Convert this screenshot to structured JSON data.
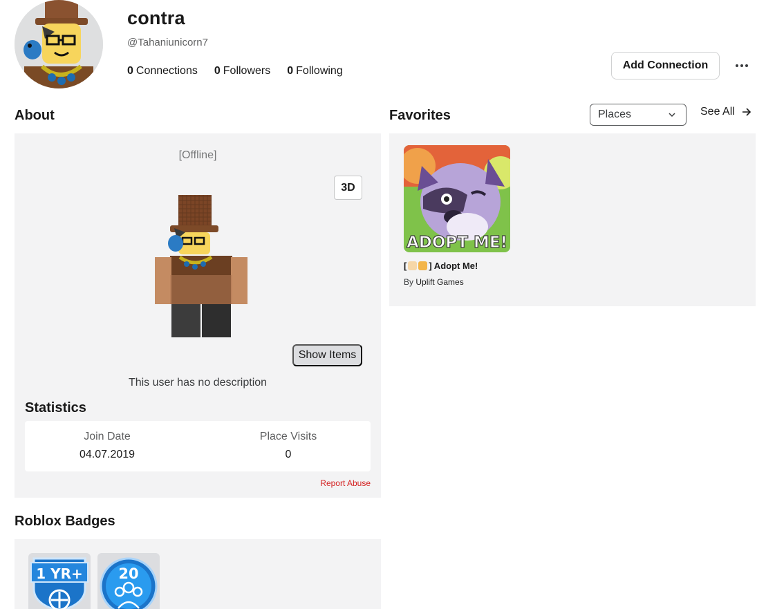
{
  "profile": {
    "display_name": "contra",
    "username": "@Tahaniunicorn7",
    "connections": {
      "count": "0",
      "label": "Connections"
    },
    "followers": {
      "count": "0",
      "label": "Followers"
    },
    "following": {
      "count": "0",
      "label": "Following"
    },
    "add_connection_label": "Add Connection",
    "more_icon": "ellipsis-icon"
  },
  "about": {
    "title": "About",
    "status": "[Offline]",
    "view_toggle_label": "3D",
    "show_items_label": "Show Items",
    "description": "This user has no description",
    "statistics": {
      "title": "Statistics",
      "join_date_label": "Join Date",
      "join_date_value": "04.07.2019",
      "place_visits_label": "Place Visits",
      "place_visits_value": "0"
    },
    "report_label": "Report Abuse"
  },
  "favorites": {
    "title": "Favorites",
    "filter_value": "Places",
    "see_all_label": "See All",
    "items": [
      {
        "name_prefix": "[",
        "name_suffix": "] Adopt Me!",
        "by_prefix": "By",
        "creator": "Uplift Games",
        "thumbnail_text": "ADOPT ME!"
      }
    ]
  },
  "badges": {
    "title": "Roblox Badges",
    "items": [
      {
        "text": "1 YR+",
        "icon": "veteran-badge-icon"
      },
      {
        "text": "20",
        "icon": "friendship-badge-icon"
      }
    ]
  },
  "colors": {
    "accent_red": "#d42121",
    "panel_bg": "#f3f3f4",
    "badge_blue": "#1b74c9"
  }
}
